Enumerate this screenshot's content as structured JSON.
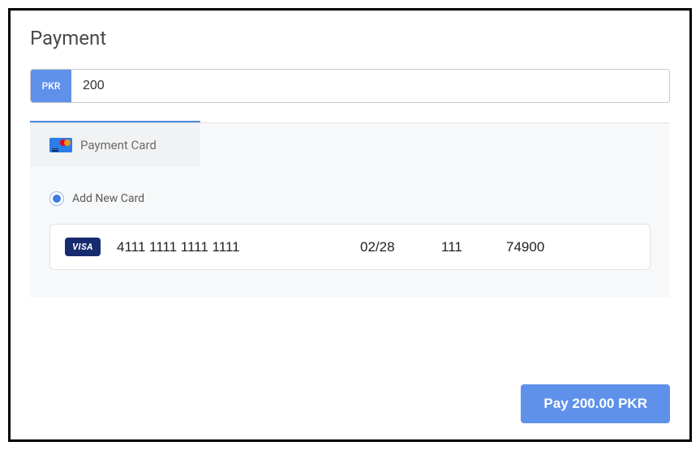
{
  "title": "Payment",
  "amount": {
    "currency": "PKR",
    "value": "200"
  },
  "method": {
    "label": "Payment Card"
  },
  "addNewCard": {
    "label": "Add New Card",
    "selected": true
  },
  "card": {
    "brand": "VISA",
    "number": "4111 1111 1111 1111",
    "expiry": "02/28",
    "cvc": "111",
    "zip": "74900"
  },
  "payButton": {
    "label": "Pay 200.00 PKR"
  }
}
